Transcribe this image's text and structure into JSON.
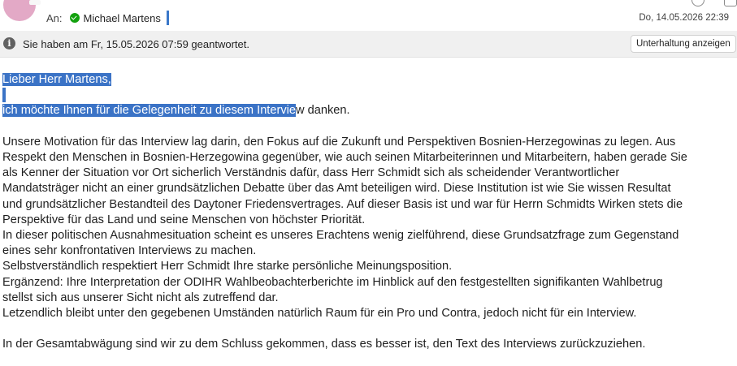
{
  "header": {
    "to_label": "An:",
    "recipient": "Michael Martens",
    "date": "Do, 14.05.2026 22:39"
  },
  "infobar": {
    "text": "Sie haben am Fr, 15.05.2026 07:59 geantwortet.",
    "conversation_button": "Unterhaltung anzeigen"
  },
  "body": {
    "greeting": "Lieber Herr Martens,",
    "thanks_selected": "ich möchte Ihnen für die Gelegenheit zu diesem Intervie",
    "thanks_rest": "w danken.",
    "p1": [
      "Unsere Motivation für das Interview lag darin, den Fokus auf die Zukunft und Perspektiven Bosnien-Herzegowinas zu legen. Aus",
      "Respekt den Menschen in Bosnien-Herzegowina gegenüber, wie auch seinen Mitarbeiterinnen und Mitarbeitern, haben gerade Sie",
      "als Kenner der Situation vor Ort sicherlich Verständnis dafür, dass Herr Schmidt sich als scheidender Verantwortlicher",
      "Mandatsträger nicht an einer grundsätzlichen Debatte über das Amt beteiligen wird. Diese Institution ist wie Sie wissen Resultat",
      "und grundsätzlicher Bestandteil des Daytoner Friedensvertrages. Auf dieser Basis ist und war für Herrn Schmidts Wirken stets die",
      "Perspektive für das Land und seine Menschen von höchster Priorität.",
      "In dieser politischen Ausnahmesituation scheint es unseres Erachtens wenig zielführend, diese Grundsatzfrage zum Gegenstand",
      "eines sehr konfrontativen Interviews zu machen.",
      "Selbstverständlich respektiert Herr Schmidt Ihre starke persönliche Meinungsposition.",
      "Ergänzend: Ihre Interpretation der ODIHR Wahlbeobachterberichte im Hinblick auf den festgestellten signifikanten Wahlbetrug",
      "stellst sich aus unserer Sicht nicht als zutreffend dar.",
      "Letzendlich bleibt unter den gegebenen Umständen natürlich Raum für ein Pro und Contra, jedoch nicht für ein Interview."
    ],
    "p2": "In der Gesamtabwägung sind wir zu dem Schluss gekommen, dass es besser ist, den Text des Interviews zurückzuziehen."
  },
  "colors": {
    "selection": "#3b73c6",
    "presence": "#13a10e",
    "avatar": "#e3a9c6",
    "infobar_bg": "#f0f0f0"
  },
  "icons": {
    "presence": "available-check-icon",
    "info": "info-icon"
  }
}
